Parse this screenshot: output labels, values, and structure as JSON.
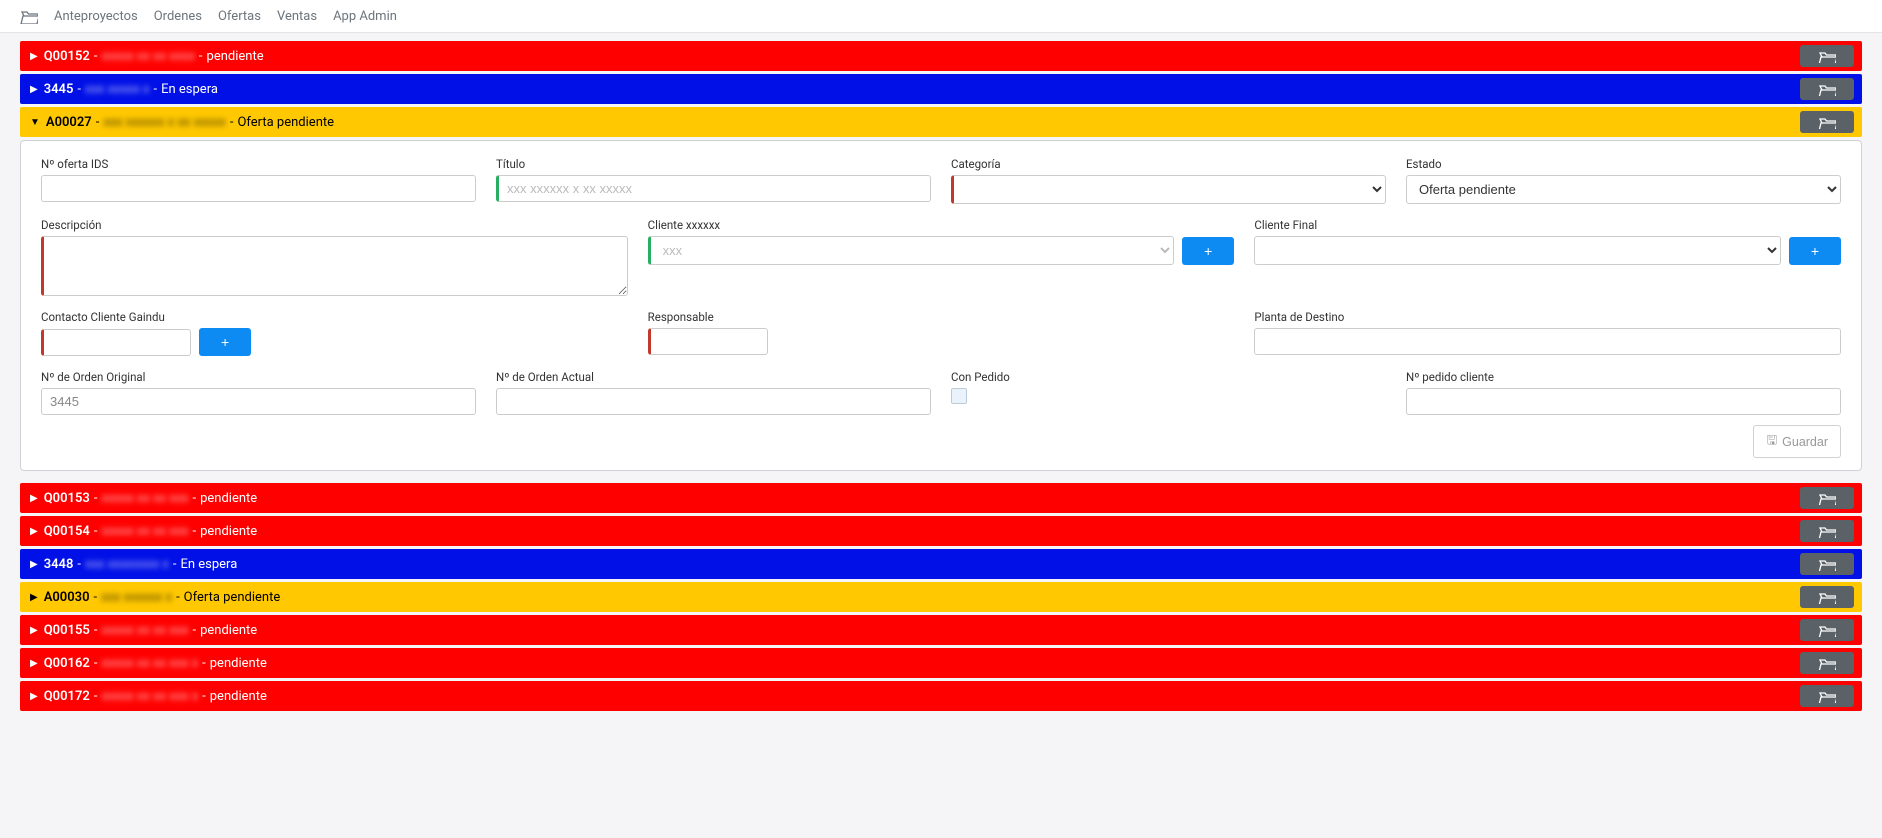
{
  "nav": {
    "anteproyectos": "Anteproyectos",
    "ordenes": "Ordenes",
    "ofertas": "Ofertas",
    "ventas": "Ventas",
    "appadmin": "App Admin"
  },
  "rows": [
    {
      "code": "Q00152",
      "blurred": "xxxxx xx xx xxxx",
      "status": "pendiente",
      "color": "red",
      "expanded": false
    },
    {
      "code": "3445",
      "blurred": "xxx xxxxx x",
      "status": "En espera",
      "color": "blue",
      "expanded": false
    },
    {
      "code": "A00027",
      "blurred": "xxx xxxxxx x xx xxxxx",
      "status": "Oferta pendiente",
      "color": "yellow",
      "expanded": true
    }
  ],
  "rows_after": [
    {
      "code": "Q00153",
      "blurred": "xxxxx xx xx xxx",
      "status": "pendiente",
      "color": "red"
    },
    {
      "code": "Q00154",
      "blurred": "xxxxx xx xx xxx",
      "status": "pendiente",
      "color": "red"
    },
    {
      "code": "3448",
      "blurred": "xxx xxxxxxxx x",
      "status": "En espera",
      "color": "blue"
    },
    {
      "code": "A00030",
      "blurred": "xxx xxxxxx x",
      "status": "Oferta pendiente",
      "color": "yellow"
    },
    {
      "code": "Q00155",
      "blurred": "xxxxx xx xx xxx",
      "status": "pendiente",
      "color": "red"
    },
    {
      "code": "Q00162",
      "blurred": "xxxxx xx xx xxx x",
      "status": "pendiente",
      "color": "red"
    },
    {
      "code": "Q00172",
      "blurred": "xxxxx xx xx xxx x",
      "status": "pendiente",
      "color": "red"
    }
  ],
  "form": {
    "labels": {
      "n_oferta_ids": "Nº oferta IDS",
      "titulo": "Título",
      "categoria": "Categoría",
      "estado": "Estado",
      "descripcion": "Descripción",
      "cliente": "Cliente",
      "cliente_blur": "xxxxxx",
      "cliente_final": "Cliente Final",
      "contacto_cliente": "Contacto Cliente Gaindu",
      "responsable": "Responsable",
      "planta_destino": "Planta de Destino",
      "orden_original": "Nº de Orden Original",
      "orden_actual": "Nº de Orden Actual",
      "con_pedido": "Con Pedido",
      "pedido_cliente": "Nº pedido cliente",
      "guardar": "Guardar"
    },
    "values": {
      "n_oferta_ids": "",
      "titulo_blur": "xxx xxxxxx x xx xxxxx",
      "categoria": "",
      "estado": "Oferta pendiente",
      "descripcion": "",
      "cliente_blur": "xxx",
      "cliente_final": "",
      "contacto": "",
      "responsable": "",
      "planta": "",
      "orden_original": "3445",
      "orden_actual": "",
      "pedido_cliente": ""
    },
    "add_icon": "+",
    "save_icon": "✎"
  }
}
